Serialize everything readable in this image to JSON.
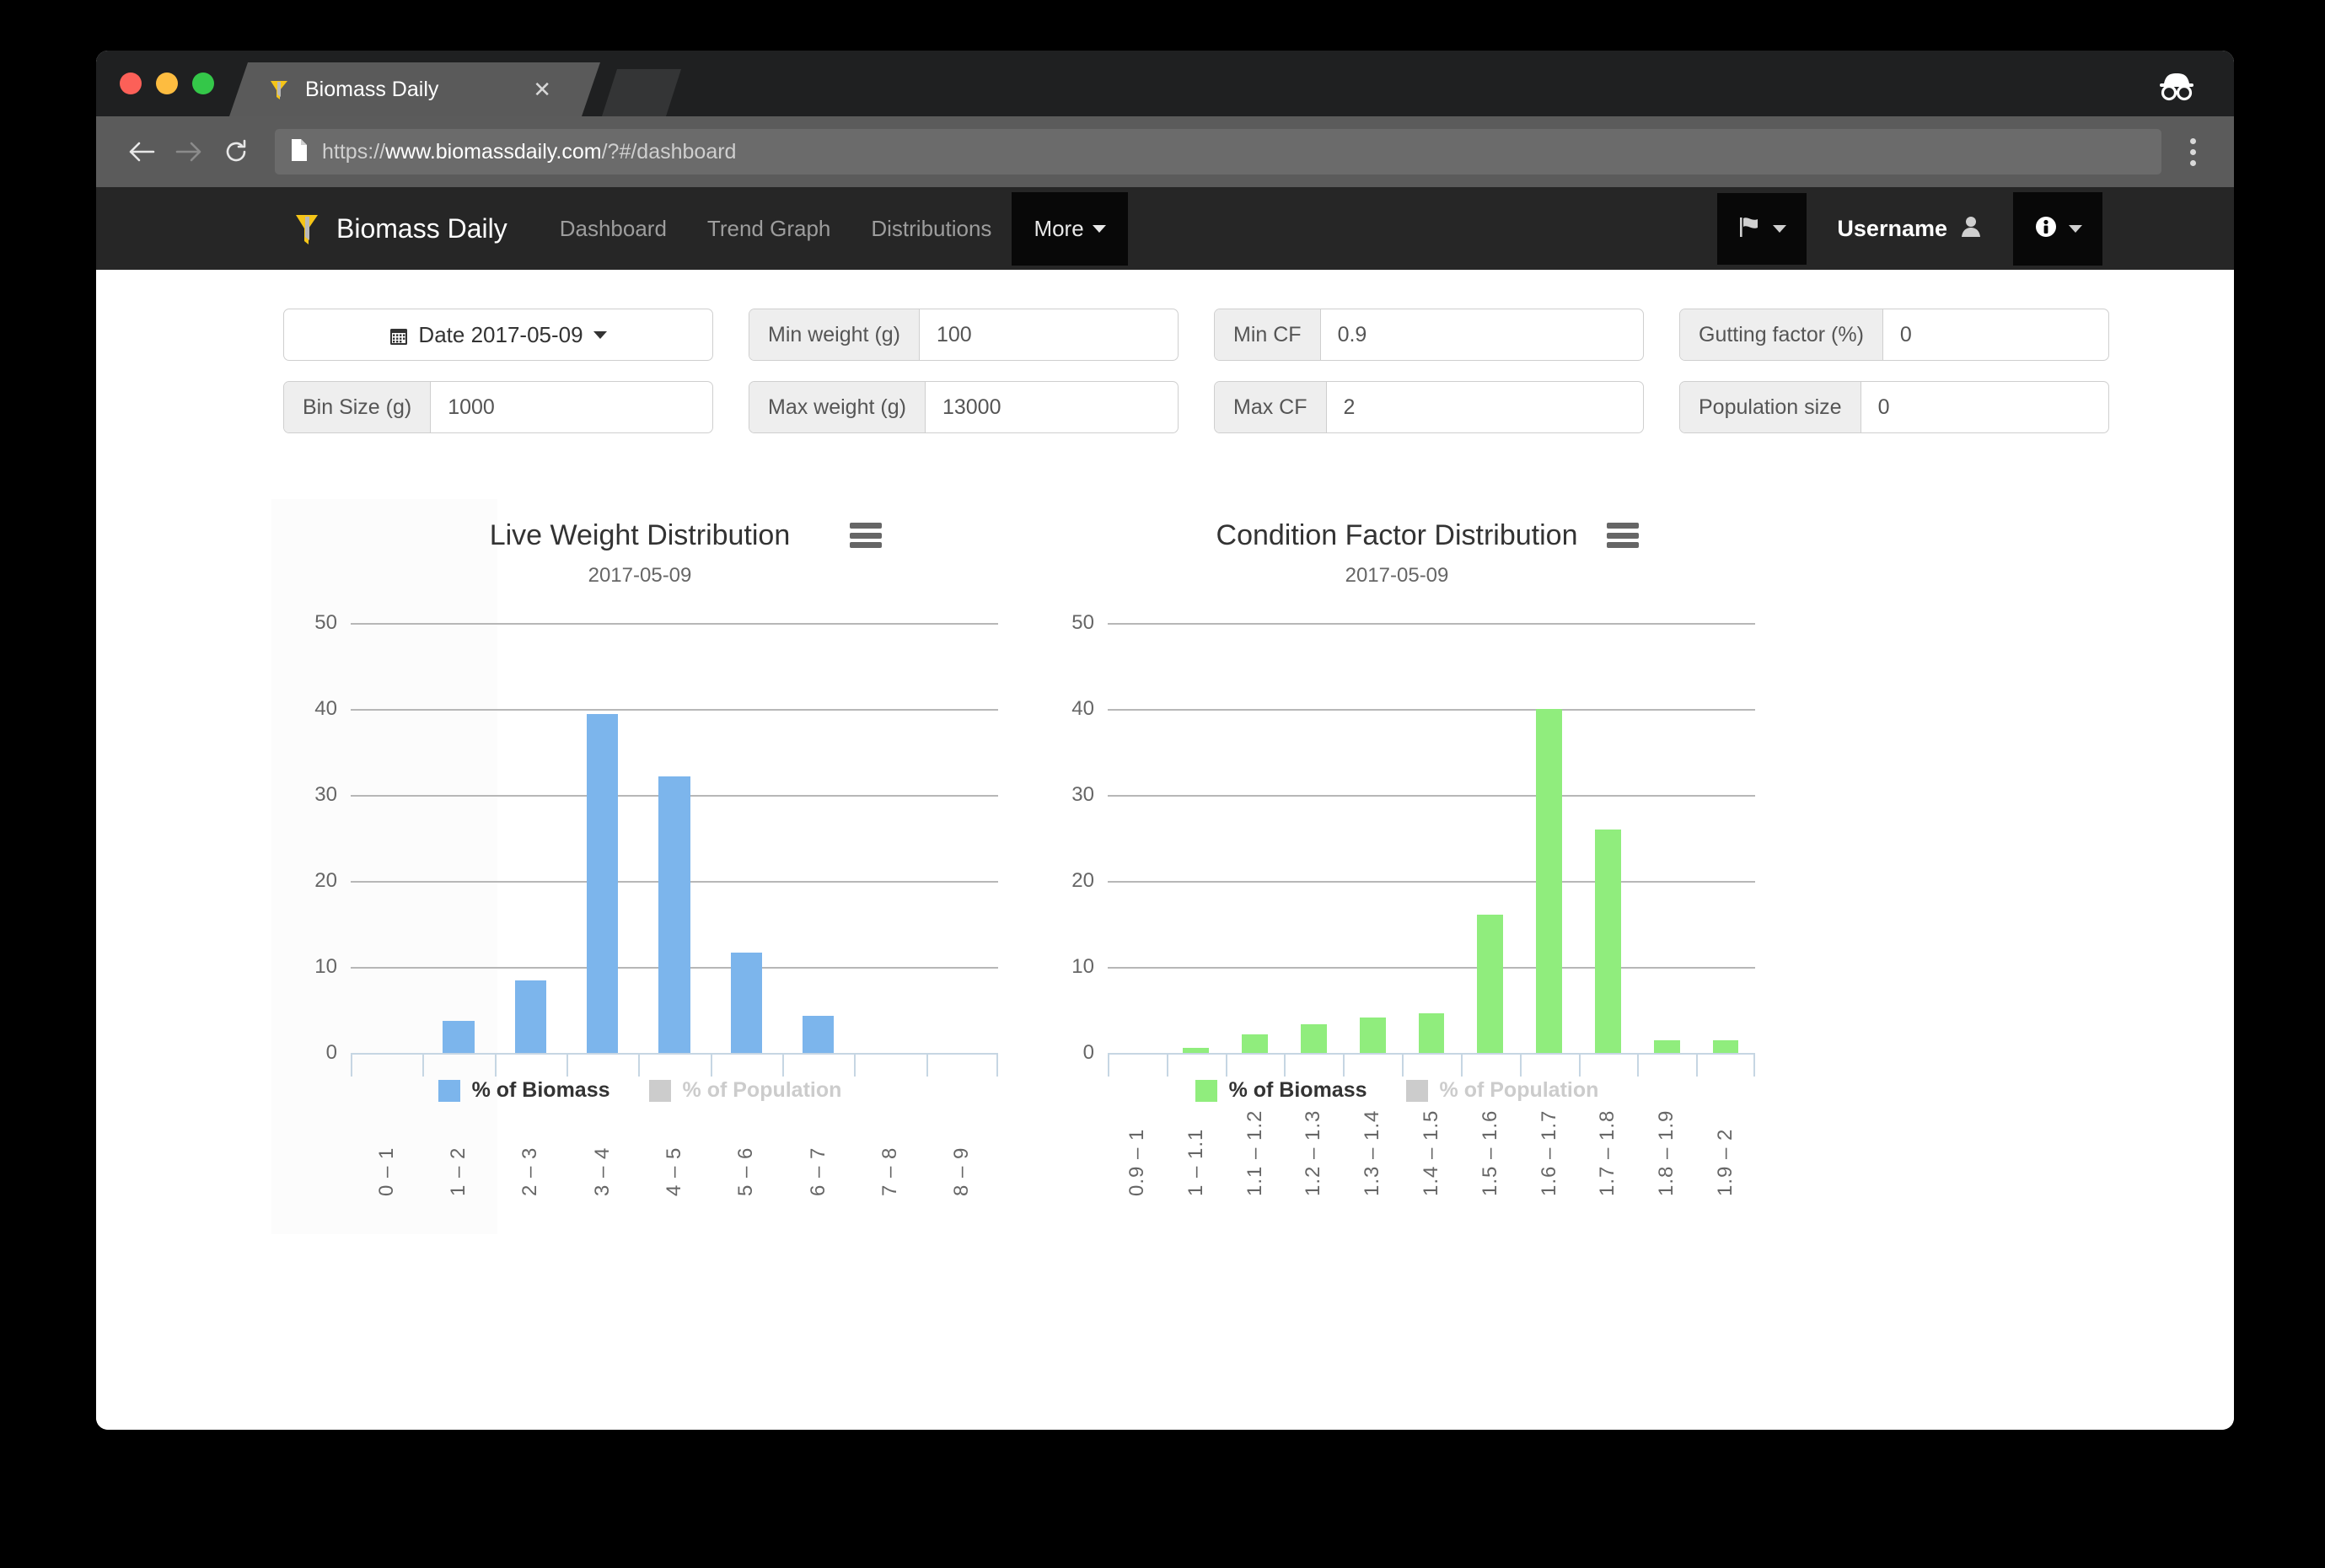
{
  "browser": {
    "tab": {
      "title": "Biomass Daily",
      "close_icon": "close-icon",
      "favicon": "biomass-logo-icon"
    },
    "incognito_icon": "incognito-icon",
    "back_icon": "back-arrow-icon",
    "forward_icon": "forward-arrow-icon",
    "reload_icon": "reload-icon",
    "page_icon": "document-icon",
    "menu_icon": "kebab-menu-icon",
    "url": {
      "scheme": "https://",
      "host": "www.biomassdaily.com",
      "path": "/?#/dashboard",
      "full": "https://www.biomassdaily.com/?#/dashboard"
    }
  },
  "navbar": {
    "brand": "Biomass Daily",
    "links": [
      {
        "label": "Dashboard"
      },
      {
        "label": "Trend Graph"
      },
      {
        "label": "Distributions"
      }
    ],
    "more": {
      "label": "More"
    },
    "flag_icon": "flag-icon",
    "username": "Username",
    "user_icon": "user-icon",
    "info_icon": "info-circle-icon"
  },
  "filters": {
    "date": {
      "label": "Date 2017-05-09",
      "icon": "calendar-icon"
    },
    "fields": [
      {
        "label": "Bin Size (g)",
        "value": "1000"
      },
      {
        "label": "Min weight (g)",
        "value": "100"
      },
      {
        "label": "Max weight (g)",
        "value": "13000"
      },
      {
        "label": "Min CF",
        "value": "0.9"
      },
      {
        "label": "Max CF",
        "value": "2"
      },
      {
        "label": "Gutting factor (%)",
        "value": "0"
      },
      {
        "label": "Population size",
        "value": "0"
      }
    ]
  },
  "chart_data": [
    {
      "type": "bar",
      "title": "Live Weight Distribution",
      "subtitle": "2017-05-09",
      "xlabel": "",
      "ylabel": "",
      "ylim": [
        0,
        50
      ],
      "yticks": [
        0,
        10,
        20,
        30,
        40,
        50
      ],
      "grid": true,
      "legend_position": "bottom",
      "color": "#7CB5EC",
      "categories": [
        "0 – 1",
        "1 – 2",
        "2 – 3",
        "3 – 4",
        "4 – 5",
        "5 – 6",
        "6 – 7",
        "7 – 8",
        "8 – 9"
      ],
      "series": [
        {
          "name": "% of Biomass",
          "color": "#7CB5EC",
          "visible": true,
          "values": [
            0,
            3.7,
            8.4,
            39.4,
            32.2,
            11.7,
            4.3,
            0,
            0
          ]
        },
        {
          "name": "% of Population",
          "color": "#CCCCCC",
          "visible": false,
          "values": []
        }
      ],
      "menu_icon": "chart-menu-icon"
    },
    {
      "type": "bar",
      "title": "Condition Factor Distribution",
      "subtitle": "2017-05-09",
      "xlabel": "",
      "ylabel": "",
      "ylim": [
        0,
        50
      ],
      "yticks": [
        0,
        10,
        20,
        30,
        40,
        50
      ],
      "grid": true,
      "legend_position": "bottom",
      "color": "#90ED7D",
      "categories": [
        "0.9 – 1",
        "1 – 1.1",
        "1.1 – 1.2",
        "1.2 – 1.3",
        "1.3 – 1.4",
        "1.4 – 1.5",
        "1.5 – 1.6",
        "1.6 – 1.7",
        "1.7 – 1.8",
        "1.8 – 1.9",
        "1.9 – 2"
      ],
      "series": [
        {
          "name": "% of Biomass",
          "color": "#90ED7D",
          "visible": true,
          "values": [
            0,
            0.6,
            2.2,
            3.3,
            4.1,
            4.6,
            16.1,
            40.0,
            26.0,
            1.5,
            1.5
          ]
        },
        {
          "name": "% of Population",
          "color": "#CCCCCC",
          "visible": false,
          "values": []
        }
      ],
      "menu_icon": "chart-menu-icon"
    }
  ],
  "colors": {
    "navbar_bg": "#262626",
    "biomass_blue": "#7CB5EC",
    "biomass_green": "#90ED7D",
    "population_gray": "#CCCCCC",
    "brand_yellow": "#F5C518"
  }
}
